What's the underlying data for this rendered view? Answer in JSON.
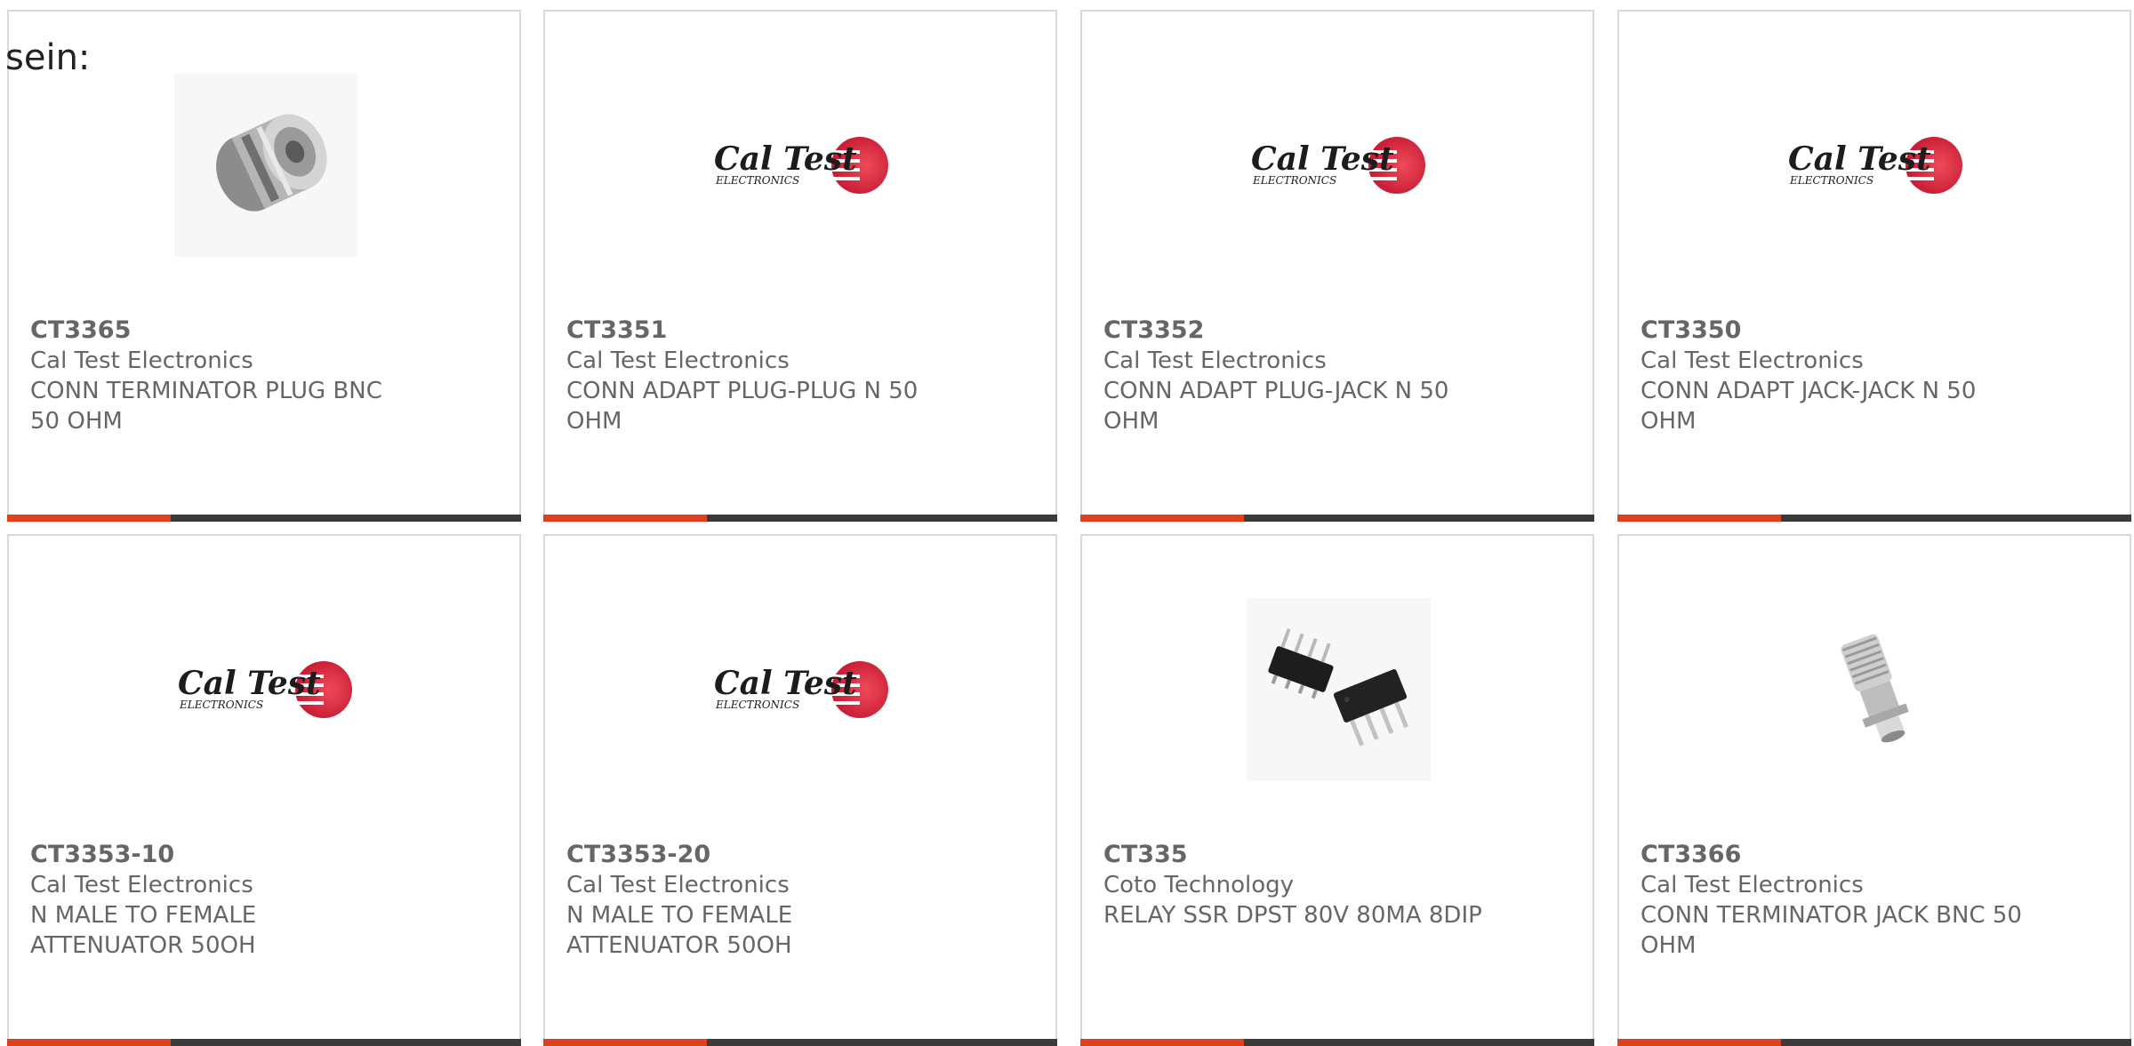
{
  "intro_text": "sein:",
  "colors": {
    "accent": "#e0401c",
    "bar": "#3a3a3a",
    "logo_red": "#d9253d",
    "text": "#666666"
  },
  "products": [
    {
      "part": "CT3365",
      "manufacturer": "Cal Test Electronics",
      "description": "CONN TERMINATOR PLUG BNC 50 OHM",
      "image": "bnc-terminator-plug-photo"
    },
    {
      "part": "CT3351",
      "manufacturer": "Cal Test Electronics",
      "description": "CONN ADAPT PLUG-PLUG N 50 OHM",
      "image": "cal-test-logo",
      "logo_line1": "Cal Test",
      "logo_line2": "ELECTRONICS"
    },
    {
      "part": "CT3352",
      "manufacturer": "Cal Test Electronics",
      "description": "CONN ADAPT PLUG-JACK N 50 OHM",
      "image": "cal-test-logo",
      "logo_line1": "Cal Test",
      "logo_line2": "ELECTRONICS"
    },
    {
      "part": "CT3350",
      "manufacturer": "Cal Test Electronics",
      "description": "CONN ADAPT JACK-JACK N 50 OHM",
      "image": "cal-test-logo",
      "logo_line1": "Cal Test",
      "logo_line2": "ELECTRONICS"
    },
    {
      "part": "CT3353-10",
      "manufacturer": "Cal Test Electronics",
      "description": "N MALE TO FEMALE ATTENUATOR 50OH",
      "image": "cal-test-logo",
      "logo_line1": "Cal Test",
      "logo_line2": "ELECTRONICS"
    },
    {
      "part": "CT3353-20",
      "manufacturer": "Cal Test Electronics",
      "description": "N MALE TO FEMALE ATTENUATOR 50OH",
      "image": "cal-test-logo",
      "logo_line1": "Cal Test",
      "logo_line2": "ELECTRONICS"
    },
    {
      "part": "CT335",
      "manufacturer": "Coto Technology",
      "description": "RELAY SSR DPST 80V 80MA 8DIP",
      "image": "dip-8-relay-photo"
    },
    {
      "part": "CT3366",
      "manufacturer": "Cal Test Electronics",
      "description": "CONN TERMINATOR JACK BNC 50 OHM",
      "image": "bnc-terminator-jack-photo"
    }
  ]
}
